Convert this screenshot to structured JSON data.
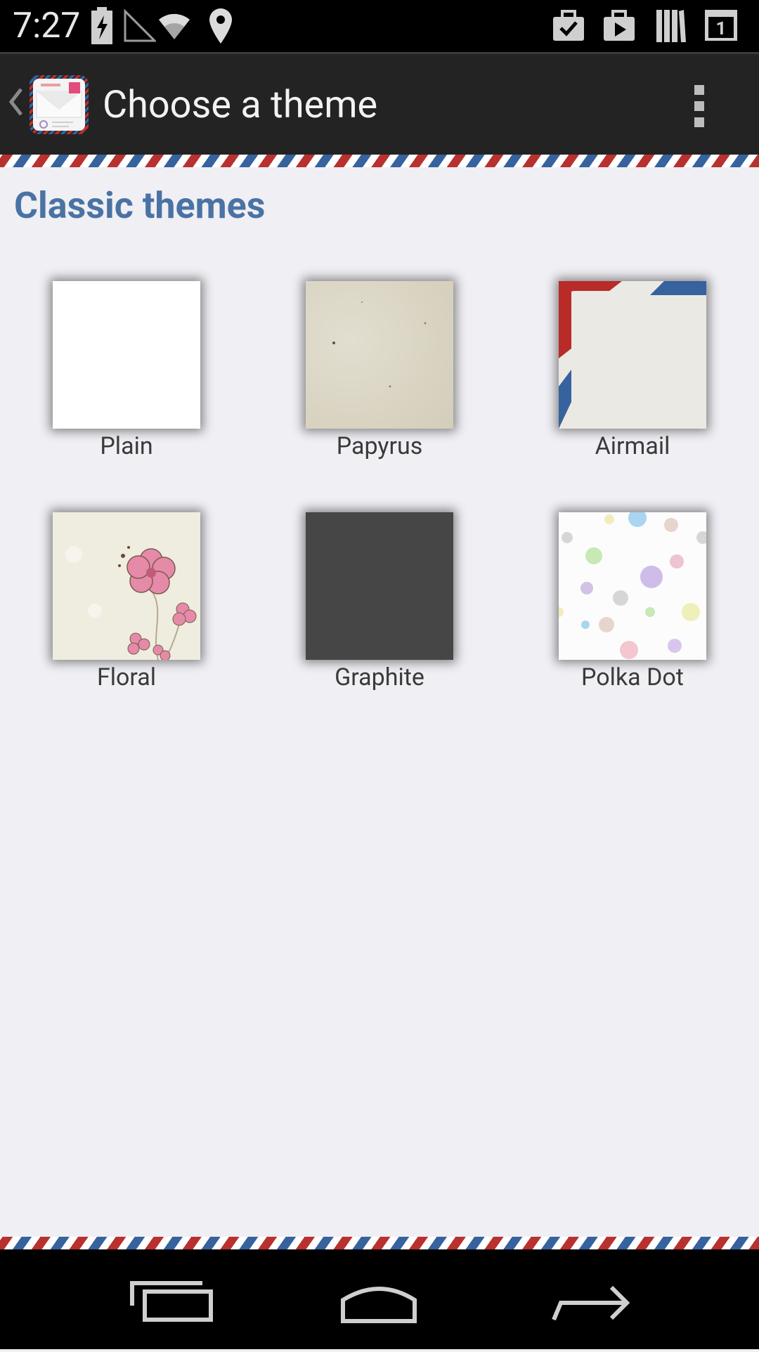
{
  "status_bar": {
    "time": "7:27",
    "icons": [
      "battery-charging-icon",
      "signal-icon",
      "wifi-icon",
      "location-icon",
      "task-check-icon",
      "play-store-icon",
      "library-icon",
      "calendar-icon"
    ],
    "calendar_day": "1"
  },
  "action_bar": {
    "title": "Choose a theme",
    "icons": [
      "back-chevron-icon",
      "app-envelope-icon",
      "overflow-menu-icon"
    ]
  },
  "section": {
    "title": "Classic themes"
  },
  "themes": [
    {
      "label": "Plain"
    },
    {
      "label": "Papyrus"
    },
    {
      "label": "Airmail"
    },
    {
      "label": "Floral"
    },
    {
      "label": "Graphite"
    },
    {
      "label": "Polka Dot"
    }
  ],
  "nav_bar": {
    "icons": [
      "recent-apps-icon",
      "home-icon",
      "back-icon"
    ]
  },
  "colors": {
    "accent": "#4a73a4",
    "stripe_red": "#b8312f",
    "stripe_blue": "#36629e",
    "background": "#efeff4"
  }
}
